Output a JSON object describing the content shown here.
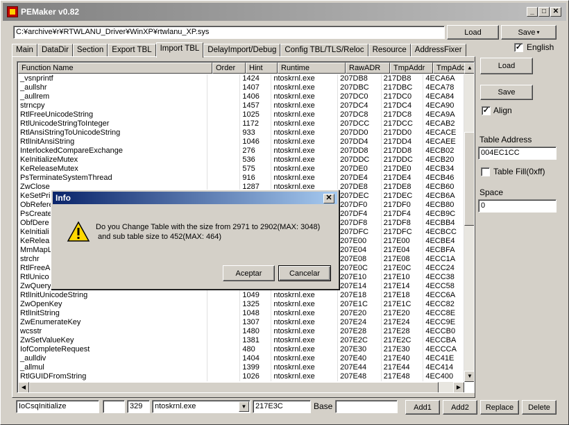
{
  "window": {
    "title": "PEMaker v0.82",
    "min": "_",
    "max": "□",
    "close": "✕"
  },
  "top": {
    "path": "C:¥archive¥r¥RTWLANU_Driver¥WinXP¥rtwlanu_XP.sys",
    "load": "Load",
    "save": "Save"
  },
  "tabs": [
    "Main",
    "DataDir",
    "Section",
    "Export TBL",
    "Import TBL",
    "DelayImport/Debug",
    "Config TBL/TLS/Reloc",
    "Resource",
    "AddressFixer"
  ],
  "active_tab": "Import TBL",
  "english": {
    "label": "English",
    "checked": true
  },
  "table": {
    "columns": [
      "Function Name",
      "Order",
      "Hint",
      "Runtime",
      "RawADR",
      "TmpAddr",
      "TmpAdd"
    ],
    "rows": [
      [
        "_vsnprintf",
        "",
        "1424",
        "ntoskrnl.exe",
        "207DB8",
        "217DB8",
        "4ECA6A"
      ],
      [
        "_aullshr",
        "",
        "1407",
        "ntoskrnl.exe",
        "207DBC",
        "217DBC",
        "4ECA78"
      ],
      [
        "_aullrem",
        "",
        "1406",
        "ntoskrnl.exe",
        "207DC0",
        "217DC0",
        "4ECA84"
      ],
      [
        "strncpy",
        "",
        "1457",
        "ntoskrnl.exe",
        "207DC4",
        "217DC4",
        "4ECA90"
      ],
      [
        "RtlFreeUnicodeString",
        "",
        "1025",
        "ntoskrnl.exe",
        "207DC8",
        "217DC8",
        "4ECA9A"
      ],
      [
        "RtlUnicodeStringToInteger",
        "",
        "1172",
        "ntoskrnl.exe",
        "207DCC",
        "217DCC",
        "4ECAB2"
      ],
      [
        "RtlAnsiStringToUnicodeString",
        "",
        "933",
        "ntoskrnl.exe",
        "207DD0",
        "217DD0",
        "4ECACE"
      ],
      [
        "RtlInitAnsiString",
        "",
        "1046",
        "ntoskrnl.exe",
        "207DD4",
        "217DD4",
        "4ECAEE"
      ],
      [
        "InterlockedCompareExchange",
        "",
        "276",
        "ntoskrnl.exe",
        "207DD8",
        "217DD8",
        "4ECB02"
      ],
      [
        "KeInitializeMutex",
        "",
        "536",
        "ntoskrnl.exe",
        "207DDC",
        "217DDC",
        "4ECB20"
      ],
      [
        "KeReleaseMutex",
        "",
        "575",
        "ntoskrnl.exe",
        "207DE0",
        "217DE0",
        "4ECB34"
      ],
      [
        "PsTerminateSystemThread",
        "",
        "916",
        "ntoskrnl.exe",
        "207DE4",
        "217DE4",
        "4ECB46"
      ],
      [
        "ZwClose",
        "",
        "1287",
        "ntoskrnl.exe",
        "207DE8",
        "217DE8",
        "4ECB60"
      ],
      [
        "KeSetPri",
        "",
        "",
        "",
        "207DEC",
        "217DEC",
        "4ECB6A"
      ],
      [
        "ObRefere",
        "",
        "",
        "",
        "207DF0",
        "217DF0",
        "4ECB80"
      ],
      [
        "PsCreate",
        "",
        "",
        "",
        "207DF4",
        "217DF4",
        "4ECB9C"
      ],
      [
        "ObfDere",
        "",
        "",
        "",
        "207DF8",
        "217DF8",
        "4ECBB4"
      ],
      [
        "KeInitiali",
        "",
        "",
        "",
        "207DFC",
        "217DFC",
        "4ECBCC"
      ],
      [
        "KeRelea",
        "",
        "",
        "",
        "207E00",
        "217E00",
        "4ECBE4"
      ],
      [
        "MmMapL",
        "",
        "",
        "",
        "207E04",
        "217E04",
        "4ECBFA"
      ],
      [
        "strchr",
        "",
        "",
        "",
        "207E08",
        "217E08",
        "4ECC1A"
      ],
      [
        "RtlFreeA",
        "",
        "",
        "",
        "207E0C",
        "217E0C",
        "4ECC24"
      ],
      [
        "RtlUnico",
        "",
        "",
        "",
        "207E10",
        "217E10",
        "4ECC38"
      ],
      [
        "ZwQuery",
        "",
        "",
        "",
        "207E14",
        "217E14",
        "4ECC58"
      ],
      [
        "RtlInitUnicodeString",
        "",
        "1049",
        "ntoskrnl.exe",
        "207E18",
        "217E18",
        "4ECC6A"
      ],
      [
        "ZwOpenKey",
        "",
        "1325",
        "ntoskrnl.exe",
        "207E1C",
        "217E1C",
        "4ECC82"
      ],
      [
        "RtlInitString",
        "",
        "1048",
        "ntoskrnl.exe",
        "207E20",
        "217E20",
        "4ECC8E"
      ],
      [
        "ZwEnumerateKey",
        "",
        "1307",
        "ntoskrnl.exe",
        "207E24",
        "217E24",
        "4ECC9E"
      ],
      [
        "wcsstr",
        "",
        "1480",
        "ntoskrnl.exe",
        "207E28",
        "217E28",
        "4ECCB0"
      ],
      [
        "ZwSetValueKey",
        "",
        "1381",
        "ntoskrnl.exe",
        "207E2C",
        "217E2C",
        "4ECCBA"
      ],
      [
        "IofCompleteRequest",
        "",
        "480",
        "ntoskrnl.exe",
        "207E30",
        "217E30",
        "4ECCCA"
      ],
      [
        "_aulldiv",
        "",
        "1404",
        "ntoskrnl.exe",
        "207E40",
        "217E40",
        "4EC41E"
      ],
      [
        "_allmul",
        "",
        "1399",
        "ntoskrnl.exe",
        "207E44",
        "217E44",
        "4EC414"
      ],
      [
        "RtlGUIDFromString",
        "",
        "1026",
        "ntoskrnl.exe",
        "207E48",
        "217E48",
        "4EC400"
      ]
    ]
  },
  "right": {
    "load": "Load",
    "save": "Save",
    "align_label": "Align",
    "align_checked": true,
    "table_address_label": "Table Address",
    "table_address": "004EC1CC",
    "table_fill_label": "Table Fill(0xff)",
    "table_fill_checked": false,
    "space_label": "Space",
    "space": "0"
  },
  "bottom": {
    "name": "IoCsqInitialize",
    "order": "",
    "hint": "329",
    "runtime": "ntoskrnl.exe",
    "address": "217E3C",
    "base_label": "Base",
    "base": "",
    "add1": "Add1",
    "add2": "Add2",
    "replace": "Replace",
    "delete": "Delete"
  },
  "dialog": {
    "title": "Info",
    "close": "✕",
    "message": "Do you Change Table with the size from 2971 to 2902(MAX: 3048)\n and sub table size to 452(MAX: 464)",
    "ok": "Aceptar",
    "cancel": "Cancelar"
  }
}
